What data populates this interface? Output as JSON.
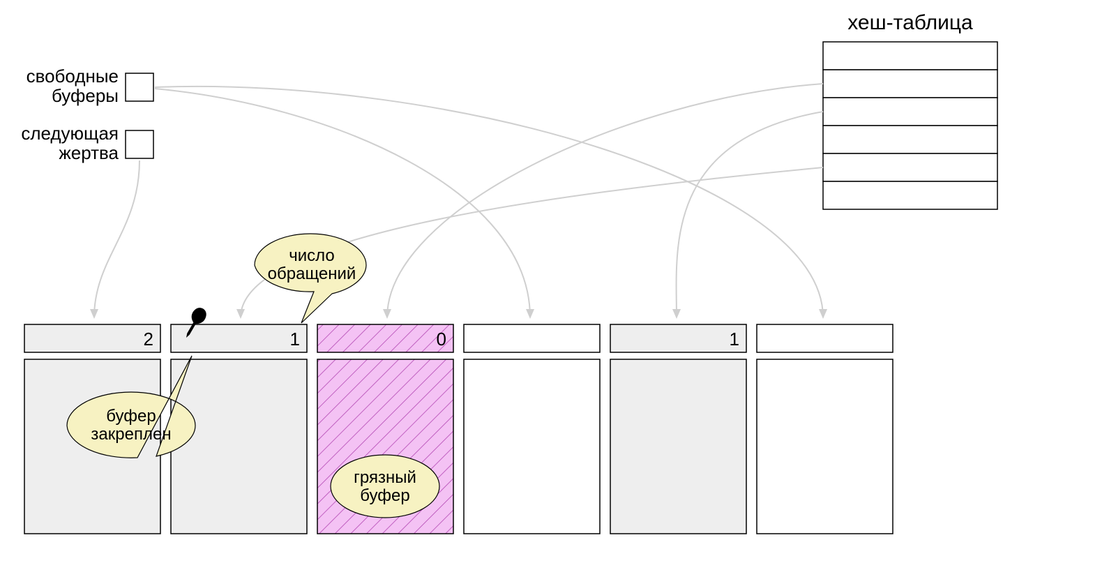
{
  "labels": {
    "free_buffers_l1": "свободные",
    "free_buffers_l2": "буферы",
    "next_victim_l1": "следующая",
    "next_victim_l2": "жертва",
    "hash_table": "хеш-таблица",
    "usage_count_l1": "число",
    "usage_count_l2": "обращений",
    "pinned_l1": "буфер",
    "pinned_l2": "закреплен",
    "dirty_l1": "грязный",
    "dirty_l2": "буфер"
  },
  "buffers": {
    "b0": "2",
    "b1": "1",
    "b2": "0",
    "b3": "",
    "b4": "1",
    "b5": ""
  }
}
